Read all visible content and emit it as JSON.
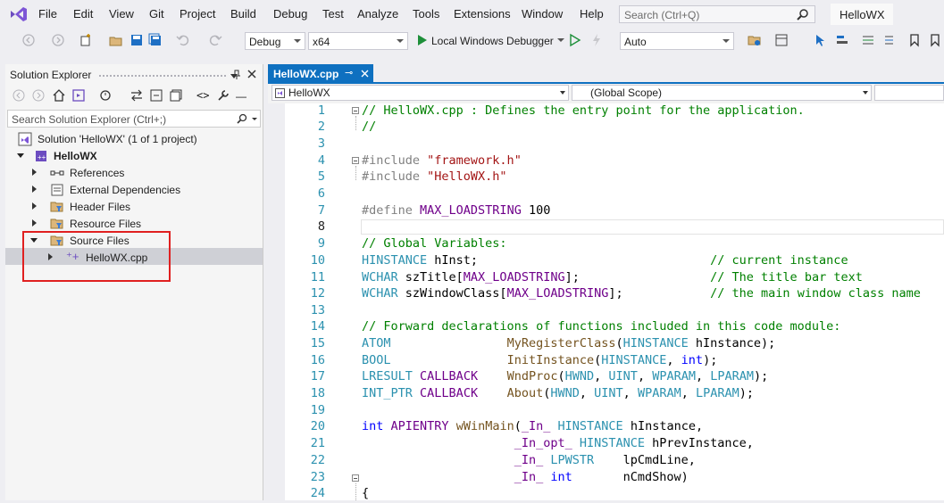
{
  "menu": [
    "File",
    "Edit",
    "View",
    "Git",
    "Project",
    "Build",
    "Debug",
    "Test",
    "Analyze",
    "Tools",
    "Extensions",
    "Window",
    "Help"
  ],
  "search_placeholder": "Search (Ctrl+Q)",
  "window_title": "HelloWX",
  "toolbar": {
    "config": "Debug",
    "platform": "x64",
    "run_label": "Local Windows Debugger",
    "auto": "Auto"
  },
  "solution_explorer": {
    "title": "Solution Explorer",
    "search_placeholder": "Search Solution Explorer (Ctrl+;)",
    "tree": [
      {
        "label": "Solution 'HelloWX' (1 of 1 project)"
      },
      {
        "label": "HelloWX"
      },
      {
        "label": "References"
      },
      {
        "label": "External Dependencies"
      },
      {
        "label": "Header Files"
      },
      {
        "label": "Resource Files"
      },
      {
        "label": "Source Files"
      },
      {
        "label": "HelloWX.cpp"
      }
    ]
  },
  "editor": {
    "tab_label": "HelloWX.cpp",
    "nav_project": "HelloWX",
    "nav_scope": "(Global Scope)",
    "line_numbers": [
      "1",
      "2",
      "3",
      "4",
      "5",
      "6",
      "7",
      "8",
      "9",
      "10",
      "11",
      "12",
      "13",
      "14",
      "15",
      "16",
      "17",
      "18",
      "19",
      "20",
      "21",
      "22",
      "23",
      "24"
    ],
    "code": {
      "l1": "// HelloWX.cpp : Defines the entry point for the application.",
      "l2": "//",
      "l4a": "#include ",
      "l4b": "\"framework.h\"",
      "l5a": "#include ",
      "l5b": "\"HelloWX.h\"",
      "l7a": "#define ",
      "l7b": "MAX_LOADSTRING",
      "l7c": " 100",
      "l9": "// Global Variables:",
      "l10a": "HINSTANCE",
      "l10b": " hInst;                                ",
      "l10c": "// current instance",
      "l11a": "WCHAR",
      "l11b": " szTitle[",
      "l11c": "MAX_LOADSTRING",
      "l11d": "];                  ",
      "l11e": "// The title bar text",
      "l12a": "WCHAR",
      "l12b": " szWindowClass[",
      "l12c": "MAX_LOADSTRING",
      "l12d": "];            ",
      "l12e": "// the main window class name",
      "l14": "// Forward declarations of functions included in this code module:",
      "l15a": "ATOM",
      "l15b": "                ",
      "l15c": "MyRegisterClass",
      "l15d": "(",
      "l15e": "HINSTANCE",
      "l15f": " hInstance);",
      "l16a": "BOOL",
      "l16b": "                ",
      "l16c": "InitInstance",
      "l16d": "(",
      "l16e": "HINSTANCE",
      "l16f": ", ",
      "l16g": "int",
      "l16h": ");",
      "l17a": "LRESULT",
      "l17b": " ",
      "l17c": "CALLBACK",
      "l17d": "    ",
      "l17e": "WndProc",
      "l17f": "(",
      "l17g": "HWND",
      "l17h": ", ",
      "l17i": "UINT",
      "l17j": ", ",
      "l17k": "WPARAM",
      "l17l": ", ",
      "l17m": "LPARAM",
      "l17n": ");",
      "l18a": "INT_PTR",
      "l18b": " ",
      "l18c": "CALLBACK",
      "l18d": "    ",
      "l18e": "About",
      "l18f": "(",
      "l18g": "HWND",
      "l18h": ", ",
      "l18i": "UINT",
      "l18j": ", ",
      "l18k": "WPARAM",
      "l18l": ", ",
      "l18m": "LPARAM",
      "l18n": ");",
      "l20a": "int",
      "l20b": " ",
      "l20c": "APIENTRY",
      "l20d": " ",
      "l20e": "wWinMain",
      "l20f": "(",
      "l20g": "_In_",
      "l20h": " ",
      "l20i": "HINSTANCE",
      "l20j": " hInstance,",
      "l21a": "                     ",
      "l21b": "_In_opt_",
      "l21c": " ",
      "l21d": "HINSTANCE",
      "l21e": " hPrevInstance,",
      "l22a": "                     ",
      "l22b": "_In_",
      "l22c": " ",
      "l22d": "LPWSTR",
      "l22e": "    lpCmdLine,",
      "l23a": "                     ",
      "l23b": "_In_",
      "l23c": " ",
      "l23d": "int",
      "l23e": "       nCmdShow)",
      "l24": "{"
    }
  }
}
